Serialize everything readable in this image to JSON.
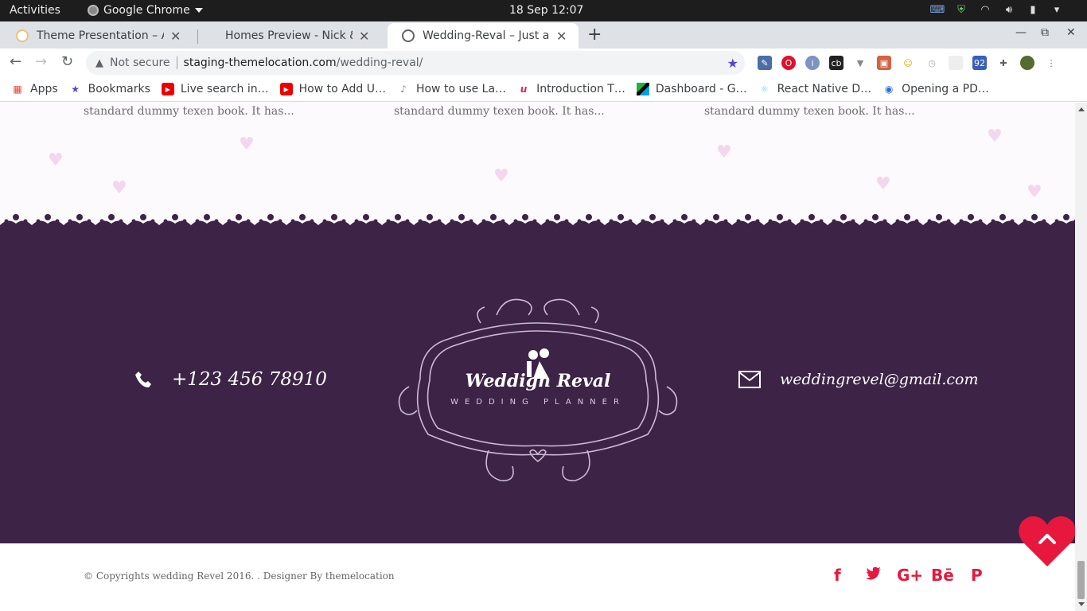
{
  "system_bar": {
    "activities": "Activities",
    "app_name": "Google Chrome",
    "clock": "18 Sep  12:07"
  },
  "tabs": [
    {
      "title": "Theme Presentation – Alis",
      "active": false
    },
    {
      "title": "Homes Preview - Nick & Sa",
      "active": false
    },
    {
      "title": "Wedding-Reval – Just and",
      "active": true
    }
  ],
  "toolbar": {
    "security_label": "Not secure",
    "url_host": "staging-themelocation.com",
    "url_path": "/wedding-reval/"
  },
  "bookmarks": [
    {
      "label": "Apps",
      "icon": "apps-grid-icon"
    },
    {
      "label": "Bookmarks",
      "icon": "star-icon"
    },
    {
      "label": "Live search in…",
      "icon": "youtube-icon"
    },
    {
      "label": "How to Add U…",
      "icon": "youtube-icon"
    },
    {
      "label": "How to use La…",
      "icon": "mic-icon"
    },
    {
      "label": "Introduction T…",
      "icon": "u-logo-icon"
    },
    {
      "label": "Dashboard - G…",
      "icon": "flag-icon"
    },
    {
      "label": "React Native D…",
      "icon": "react-icon"
    },
    {
      "label": "Opening a PD…",
      "icon": "globe-icon"
    }
  ],
  "snippets": [
    "standard dummy texen book. It has...",
    "standard dummy texen book. It has...",
    "standard dummy texen book. It has..."
  ],
  "footer": {
    "phone": "+123 456 78910",
    "email": "weddingrevel@gmail.com",
    "logo_title": "Weddign Reval",
    "logo_subtitle": "WEDDING PLANNER",
    "copyright": "© Copyrights wedding Revel 2016. . Designer By themelocation",
    "social": [
      {
        "name": "facebook-icon",
        "glyph": "f"
      },
      {
        "name": "twitter-icon",
        "glyph": "t"
      },
      {
        "name": "google-plus-icon",
        "glyph": "G+"
      },
      {
        "name": "behance-icon",
        "glyph": "Bē"
      },
      {
        "name": "pinterest-icon",
        "glyph": "P"
      }
    ]
  },
  "colors": {
    "footer_bg": "#3d2346",
    "accent": "#e8173e"
  }
}
